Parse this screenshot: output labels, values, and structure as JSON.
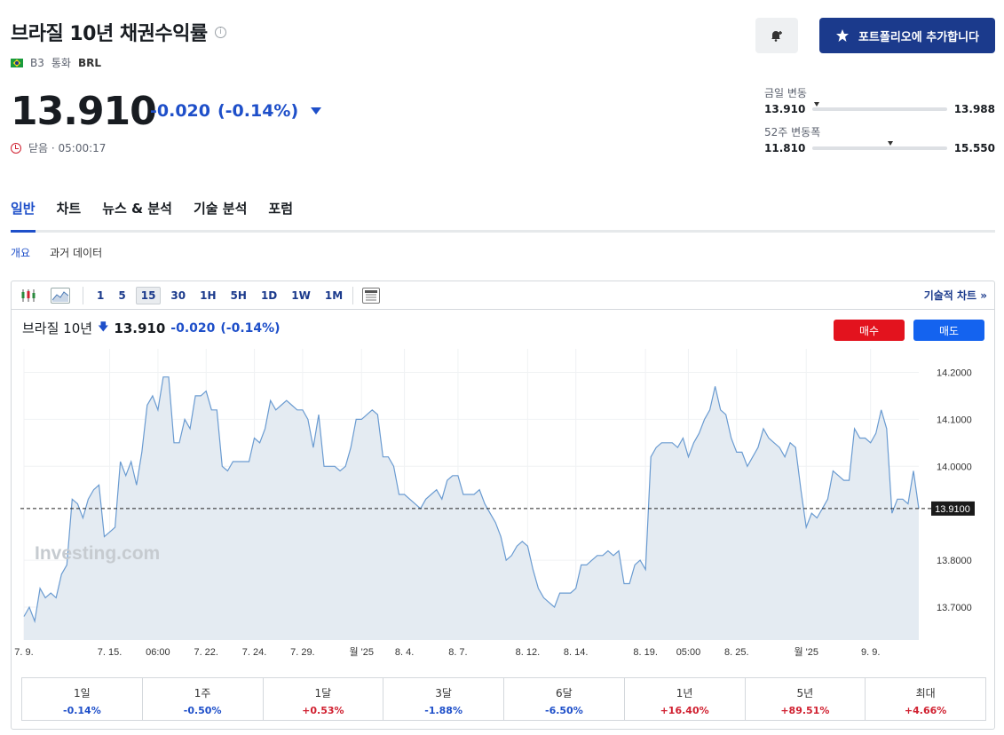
{
  "header": {
    "title": "브라질 10년 채권수익률",
    "info_icon": "info-icon",
    "exchange": "B3",
    "currency_label": "통화",
    "currency": "BRL",
    "bell_icon": "bell-plus-icon",
    "portfolio_button": "포트폴리오에 추가합니다"
  },
  "quote": {
    "price": "13.910",
    "change": "-0.020",
    "change_pct": "(-0.14%)",
    "status": "닫음 · 05:00:17"
  },
  "ranges": {
    "day": {
      "label": "금일 변동",
      "low": "13.910",
      "high": "13.988",
      "position": 0.01
    },
    "year": {
      "label": "52주 변동폭",
      "low": "11.810",
      "high": "15.550",
      "position": 0.56
    }
  },
  "tabs": [
    "일반",
    "차트",
    "뉴스 & 분석",
    "기술 분석",
    "포럼"
  ],
  "subtabs": [
    "개요",
    "과거 데이터"
  ],
  "toolbar": {
    "timeframes": [
      "1",
      "5",
      "15",
      "30",
      "1H",
      "5H",
      "1D",
      "1W",
      "1M"
    ],
    "active_timeframe": "15",
    "tech_chart_link": "기술적 차트 »"
  },
  "chart_header": {
    "name": "브라질 10년",
    "price": "13.910",
    "change": "-0.020",
    "change_pct": "(-0.14%)",
    "buy": "매수",
    "sell": "매도"
  },
  "colors": {
    "accent": "#1e4fc9",
    "brand": "#1b3a8c",
    "buy": "#e3131e",
    "sell": "#1463ef",
    "line": "#6a9bd1",
    "area": "#e4ebf2"
  },
  "chart_data": {
    "type": "area",
    "watermark": "Investing.com",
    "current_value": 13.91,
    "current_label": "13.9100",
    "ylim": [
      13.63,
      14.25
    ],
    "yticks": [
      "14.2000",
      "14.1000",
      "14.0000",
      "13.8000",
      "13.7000"
    ],
    "ytick_values": [
      14.2,
      14.1,
      14.0,
      13.8,
      13.7
    ],
    "xticks": [
      "7. 9.",
      "7. 15.",
      "06:00",
      "7. 22.",
      "7. 24.",
      "7. 29.",
      "월 '25",
      "8. 4.",
      "8. 7.",
      "8. 12.",
      "8. 14.",
      "8. 19.",
      "05:00",
      "8. 25.",
      "월 '25",
      "9. 9."
    ],
    "xtick_index": [
      0,
      16,
      25,
      34,
      43,
      52,
      63,
      71,
      81,
      94,
      103,
      116,
      124,
      133,
      146,
      158
    ],
    "grid": true,
    "series": [
      {
        "values": [
          13.68,
          13.7,
          13.67,
          13.74,
          13.72,
          13.73,
          13.72,
          13.77,
          13.79,
          13.93,
          13.92,
          13.89,
          13.93,
          13.95,
          13.96,
          13.85,
          13.86,
          13.87,
          14.01,
          13.98,
          14.01,
          13.96,
          14.03,
          14.13,
          14.15,
          14.12,
          14.19,
          14.19,
          14.05,
          14.05,
          14.1,
          14.08,
          14.15,
          14.15,
          14.16,
          14.12,
          14.12,
          14.0,
          13.99,
          14.01,
          14.01,
          14.01,
          14.01,
          14.06,
          14.05,
          14.08,
          14.14,
          14.12,
          14.13,
          14.14,
          14.13,
          14.12,
          14.12,
          14.1,
          14.04,
          14.11,
          14.0,
          14.0,
          14.0,
          13.99,
          14.0,
          14.04,
          14.1,
          14.1,
          14.11,
          14.12,
          14.11,
          14.02,
          14.02,
          14.0,
          13.94,
          13.94,
          13.93,
          13.92,
          13.91,
          13.93,
          13.94,
          13.95,
          13.93,
          13.97,
          13.98,
          13.98,
          13.94,
          13.94,
          13.94,
          13.95,
          13.92,
          13.9,
          13.88,
          13.85,
          13.8,
          13.81,
          13.83,
          13.84,
          13.83,
          13.78,
          13.74,
          13.72,
          13.71,
          13.7,
          13.73,
          13.73,
          13.73,
          13.74,
          13.79,
          13.79,
          13.8,
          13.81,
          13.81,
          13.82,
          13.81,
          13.82,
          13.75,
          13.75,
          13.79,
          13.8,
          13.78,
          14.02,
          14.04,
          14.05,
          14.05,
          14.05,
          14.04,
          14.06,
          14.02,
          14.05,
          14.07,
          14.1,
          14.12,
          14.17,
          14.12,
          14.11,
          14.06,
          14.03,
          14.03,
          14.0,
          14.02,
          14.04,
          14.08,
          14.06,
          14.05,
          14.04,
          14.02,
          14.05,
          14.04,
          13.95,
          13.87,
          13.9,
          13.89,
          13.91,
          13.93,
          13.99,
          13.98,
          13.97,
          13.97,
          14.08,
          14.06,
          14.06,
          14.05,
          14.07,
          14.12,
          14.08,
          13.9,
          13.93,
          13.93,
          13.92,
          13.99,
          13.91
        ]
      }
    ]
  },
  "performance": [
    {
      "label": "1일",
      "value": "-0.14%",
      "dir": "neg"
    },
    {
      "label": "1주",
      "value": "-0.50%",
      "dir": "neg"
    },
    {
      "label": "1달",
      "value": "+0.53%",
      "dir": "pos"
    },
    {
      "label": "3달",
      "value": "-1.88%",
      "dir": "neg"
    },
    {
      "label": "6달",
      "value": "-6.50%",
      "dir": "neg"
    },
    {
      "label": "1년",
      "value": "+16.40%",
      "dir": "pos"
    },
    {
      "label": "5년",
      "value": "+89.51%",
      "dir": "pos"
    },
    {
      "label": "최대",
      "value": "+4.66%",
      "dir": "pos"
    }
  ]
}
